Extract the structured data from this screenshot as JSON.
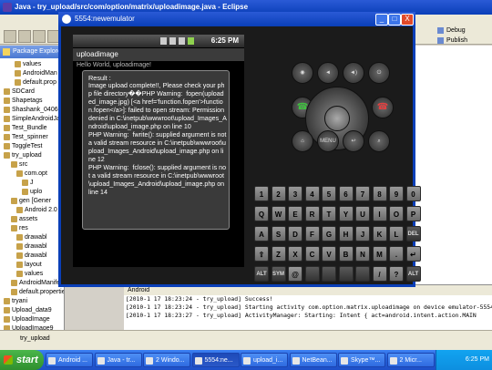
{
  "eclipse": {
    "title": "Java - try_upload/src/com/option/matrix/uploadimage.java - Eclipse",
    "perspectives": [
      "Debug",
      "Publish"
    ],
    "package_explorer": "Package Explorer",
    "tree": [
      "values",
      "AndroidMan",
      "default.prop",
      "SDCard",
      "Shapetags",
      "Shashank_0406",
      "SimpleAndroidJa",
      "Test_Bundle",
      "Test_spinner",
      "ToggleTest",
      "try_upload",
      "src",
      "com.opt",
      "J",
      "uplo",
      "gen [Gener",
      "Android 2.0",
      "assets",
      "res",
      "drawabl",
      "drawabl",
      "drawabl",
      "layout",
      "values",
      "AndroidManifest.xml",
      "default.properties",
      "tryani",
      "Upload_data9",
      "UploadImage",
      "UploadImage9"
    ],
    "console_tab": "Android",
    "console_lines": [
      "[2010-1  17 18:23:24 - try_upload] Success!",
      "[2010-1  17 18:23:24 - try_upload] Starting activity com.option.matrix.uploadimage on device emulator-5554",
      "[2010-1  17 18:23:27 - try_upload] ActivityManager: Starting: Intent { act=android.intent.action.MAIN"
    ],
    "status_text": "try_upload"
  },
  "emulator": {
    "title": "5554:newemulator",
    "window_buttons": {
      "minimize": "_",
      "maximize": "□",
      "close": "X"
    },
    "phone_time": "6:25 PM",
    "app_title": "uploadimage",
    "hello": "Hello World, uploadimage!",
    "dialog_title": "Result :",
    "dialog_message": "Image upload complete!!, Please check your php file directory��PHP Warning:  fopen(uploaded_image.jpg) [<a href='function.fopen'>function.fopen</a>]: failed to open stream: Permission denied in C:\\inetpub\\wwwroot\\upload_Images_Android\\upload_image.php on line 10\nPHP Warning:  fwrite(): supplied argument is not a valid stream resource in C:\\inetpub\\wwwroot\\upload_Images_Android\\upload_image.php on line 12\nPHP Warning:  fclose(): supplied argument is not a valid stream resource in C:\\inetpub\\wwwroot\\upload_Images_Android\\upload_image.php on line 14",
    "menu_label": "MENU",
    "keyboard": {
      "row1": [
        "1",
        "2",
        "3",
        "4",
        "5",
        "6",
        "7",
        "8",
        "9",
        "0"
      ],
      "row2": [
        "Q",
        "W",
        "E",
        "R",
        "T",
        "Y",
        "U",
        "I",
        "O",
        "P"
      ],
      "row3": [
        "A",
        "S",
        "D",
        "F",
        "G",
        "H",
        "J",
        "K",
        "L",
        "DEL"
      ],
      "row4": [
        "⇧",
        "Z",
        "X",
        "C",
        "V",
        "B",
        "N",
        "M",
        ".",
        "↵"
      ],
      "row5": [
        "ALT",
        "SYM",
        "@",
        "",
        "",
        "",
        "",
        "/",
        "?",
        "ALT"
      ]
    }
  },
  "taskbar": {
    "start": "start",
    "tasks": [
      "Android ...",
      "Java - tr...",
      "2 Windo...",
      "5554:ne...",
      "upload_i...",
      "NetBean...",
      "Skype™...",
      "2 Micr..."
    ],
    "clock": "6:25 PM"
  }
}
